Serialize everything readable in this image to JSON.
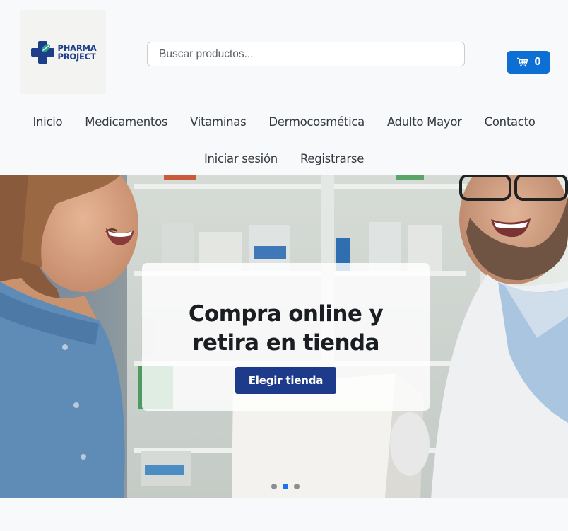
{
  "brand": {
    "line1": "PHARMA",
    "line2": "PROJECT",
    "colors": {
      "navy": "#1f3e8a",
      "teal": "#2aa58c"
    }
  },
  "search": {
    "placeholder": "Buscar productos..."
  },
  "cart": {
    "icon": "cart-icon",
    "count": "0"
  },
  "nav": {
    "primary": [
      "Inicio",
      "Medicamentos",
      "Vitaminas",
      "Dermocosmética",
      "Adulto Mayor",
      "Contacto"
    ],
    "secondary": [
      "Iniciar sesión",
      "Registrarse"
    ]
  },
  "hero": {
    "title": "Compra online y retira en tienda",
    "button": "Elegir tienda",
    "carousel": {
      "slides": 3,
      "active_index": 1
    }
  },
  "colors": {
    "accent": "#0d6ed3",
    "button": "#1e3a8a"
  }
}
